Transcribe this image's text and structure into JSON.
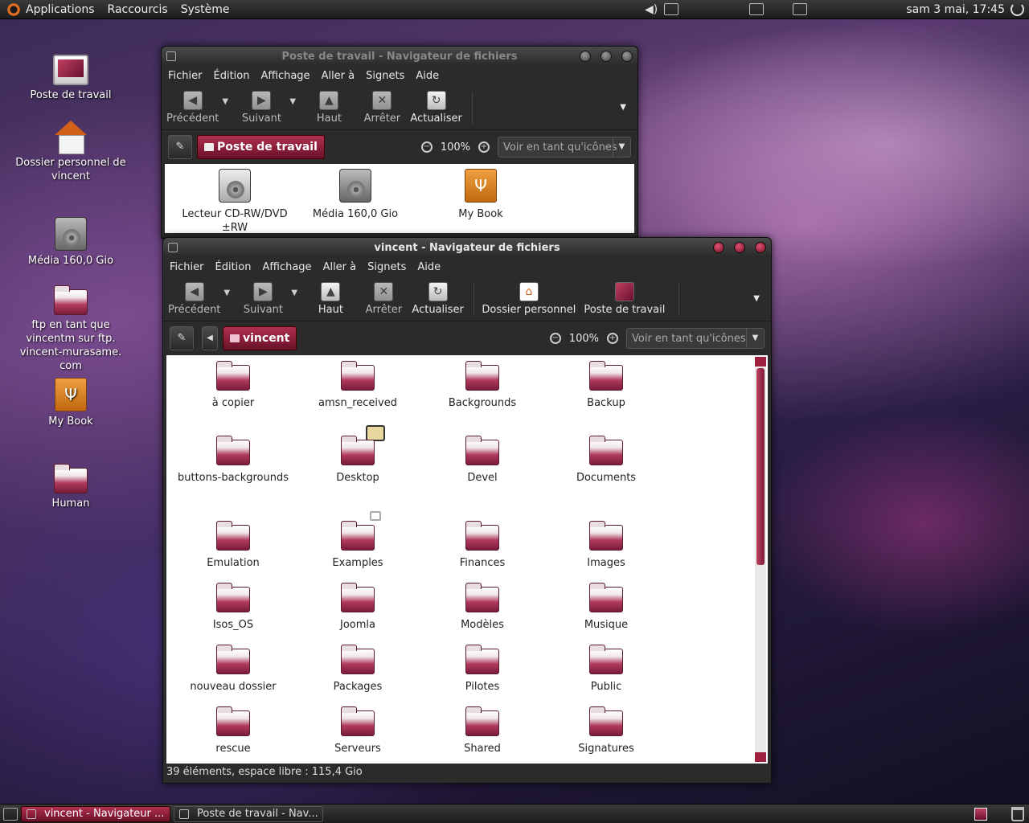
{
  "top_panel": {
    "menus": [
      "Applications",
      "Raccourcis",
      "Système"
    ],
    "clock": "sam  3 mai, 17:45"
  },
  "desktop_icons": [
    {
      "label": "Poste de travail",
      "icon": "computer-icon"
    },
    {
      "label": "Dossier personnel de vincent",
      "icon": "home-folder-icon"
    },
    {
      "label": "Média 160,0 Gio",
      "icon": "harddisk-icon"
    },
    {
      "label": "ftp en tant que vincentm sur ftp. vincent-murasame. com",
      "icon": "network-folder-icon"
    },
    {
      "label": "My Book",
      "icon": "usb-drive-icon"
    },
    {
      "label": "Human",
      "icon": "folder-icon"
    }
  ],
  "win_back": {
    "title": "Poste de travail - Navigateur de fichiers",
    "menus": [
      "Fichier",
      "Édition",
      "Affichage",
      "Aller à",
      "Signets",
      "Aide"
    ],
    "toolbar": {
      "back": "Précédent",
      "forward": "Suivant",
      "up": "Haut",
      "stop": "Arrêter",
      "reload": "Actualiser"
    },
    "location": "Poste de travail",
    "zoom": "100%",
    "view": "Voir en tant qu'icônes",
    "items": [
      "Lecteur CD-RW/DVD ±RW",
      "Média 160,0 Gio",
      "My Book"
    ]
  },
  "win_front": {
    "title": "vincent - Navigateur de fichiers",
    "menus": [
      "Fichier",
      "Édition",
      "Affichage",
      "Aller à",
      "Signets",
      "Aide"
    ],
    "toolbar": {
      "back": "Précédent",
      "forward": "Suivant",
      "up": "Haut",
      "stop": "Arrêter",
      "reload": "Actualiser",
      "home": "Dossier personnel",
      "computer": "Poste de travail"
    },
    "location": "vincent",
    "zoom": "100%",
    "view": "Voir en tant qu'icônes",
    "folders": [
      "à copier",
      "amsn_received",
      "Backgrounds",
      "Backup",
      "buttons-backgrounds",
      "Desktop",
      "Devel",
      "Documents",
      "Emulation",
      "Examples",
      "Finances",
      "Images",
      "Isos_OS",
      "Joomla",
      "Modèles",
      "Musique",
      "nouveau dossier",
      "Packages",
      "Pilotes",
      "Public",
      "rescue",
      "Serveurs",
      "Shared",
      "Signatures"
    ],
    "status": "39 éléments, espace libre : 115,4 Gio"
  },
  "taskbar": [
    "vincent - Navigateur ...",
    "Poste de travail - Nav..."
  ]
}
